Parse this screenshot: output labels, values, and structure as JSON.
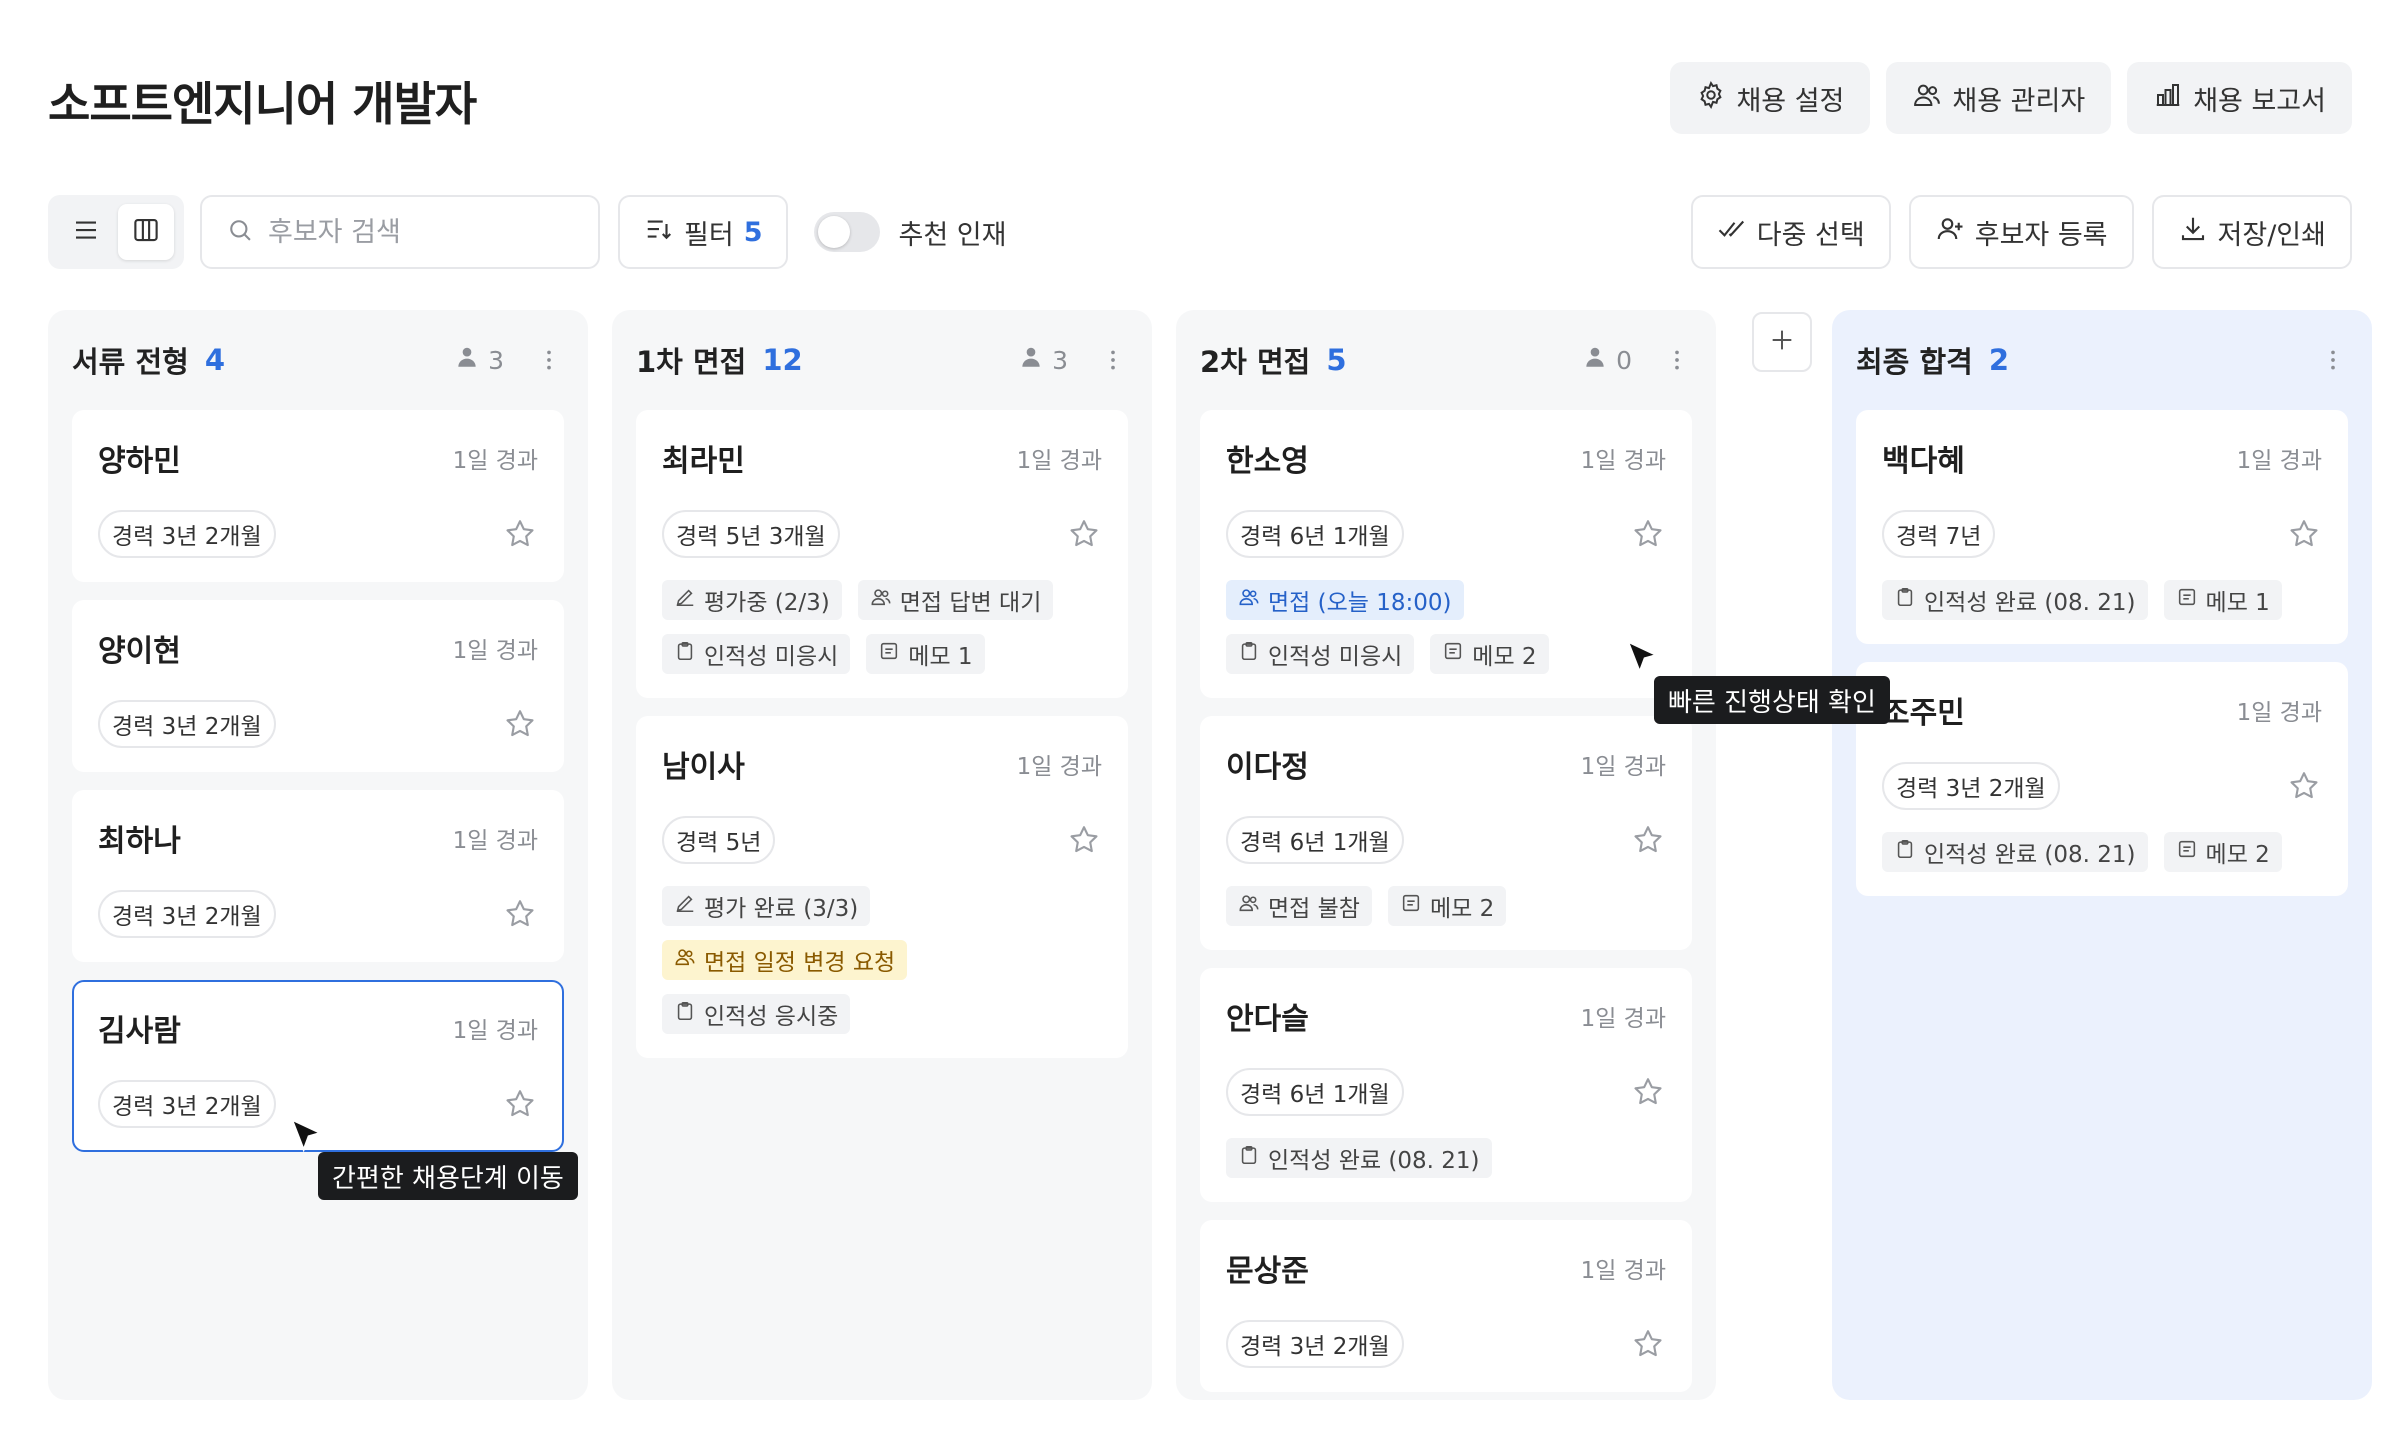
{
  "page": {
    "title": "소프트엔지니어 개발자"
  },
  "top_actions": [
    {
      "label": "채용 설정",
      "icon": "gear-icon"
    },
    {
      "label": "채용 관리자",
      "icon": "users-icon"
    },
    {
      "label": "채용 보고서",
      "icon": "bar-chart-icon"
    }
  ],
  "toolbar": {
    "search_placeholder": "후보자 검색",
    "filter_label": "필터",
    "filter_count": "5",
    "toggle_label": "추천 인재",
    "toggle_on": false,
    "actions": [
      {
        "label": "다중 선택",
        "icon": "double-check-icon"
      },
      {
        "label": "후보자 등록",
        "icon": "add-user-icon"
      },
      {
        "label": "저장/인쇄",
        "icon": "download-icon"
      }
    ]
  },
  "colors": {
    "accent": "#2f6fde",
    "final_column_bg": "#ebf1fd",
    "column_bg": "#f6f7f8"
  },
  "columns": [
    {
      "title": "서류 전형",
      "count": "4",
      "reviewers": "3",
      "cards": [
        {
          "name": "양하민",
          "elapsed": "1일 경과",
          "experience": "경력 3년 2개월",
          "tags": []
        },
        {
          "name": "양이현",
          "elapsed": "1일 경과",
          "experience": "경력 3년 2개월",
          "tags": []
        },
        {
          "name": "최하나",
          "elapsed": "1일 경과",
          "experience": "경력 3년 2개월",
          "tags": []
        },
        {
          "name": "김사람",
          "elapsed": "1일 경과",
          "experience": "경력 3년 2개월",
          "tags": []
        }
      ]
    },
    {
      "title": "1차 면접",
      "count": "12",
      "reviewers": "3",
      "cards": [
        {
          "name": "최라민",
          "elapsed": "1일 경과",
          "experience": "경력 5년 3개월",
          "tags": [
            {
              "label": "평가중 (2/3)",
              "icon": "pencil-icon"
            },
            {
              "label": "면접 답변 대기",
              "icon": "users-icon"
            },
            {
              "label": "인적성 미응시",
              "icon": "clipboard-icon"
            },
            {
              "label": "메모 1",
              "icon": "note-icon"
            }
          ]
        },
        {
          "name": "남이사",
          "elapsed": "1일 경과",
          "experience": "경력 5년",
          "tags": [
            {
              "label": "평가 완료 (3/3)",
              "icon": "pencil-icon"
            },
            {
              "label": "면접 일정 변경 요청",
              "icon": "users-icon"
            },
            {
              "label": "인적성 응시중",
              "icon": "clipboard-icon"
            }
          ]
        }
      ]
    },
    {
      "title": "2차 면접",
      "count": "5",
      "reviewers": "0",
      "cards": [
        {
          "name": "한소영",
          "elapsed": "1일 경과",
          "experience": "경력 6년 1개월",
          "tags": [
            {
              "label": "면접 (오늘 18:00)",
              "icon": "users-icon"
            },
            {
              "label": "인적성 미응시",
              "icon": "clipboard-icon"
            },
            {
              "label": "메모 2",
              "icon": "note-icon"
            }
          ]
        },
        {
          "name": "이다정",
          "elapsed": "1일 경과",
          "experience": "경력 6년 1개월",
          "tags": [
            {
              "label": "면접 불참",
              "icon": "users-icon"
            },
            {
              "label": "메모 2",
              "icon": "note-icon"
            }
          ]
        },
        {
          "name": "안다슬",
          "elapsed": "1일 경과",
          "experience": "경력 6년 1개월",
          "tags": [
            {
              "label": "인적성 완료 (08. 21)",
              "icon": "clipboard-icon"
            }
          ]
        },
        {
          "name": "문상준",
          "elapsed": "1일 경과",
          "experience": "경력 3년 2개월",
          "tags": []
        }
      ]
    },
    {
      "title": "최종 합격",
      "count": "2",
      "cards": [
        {
          "name": "백다혜",
          "elapsed": "1일 경과",
          "experience": "경력 7년",
          "tags": [
            {
              "label": "인적성 완료 (08. 21)",
              "icon": "clipboard-icon"
            },
            {
              "label": "메모 1",
              "icon": "note-icon"
            }
          ]
        },
        {
          "name": "조주민",
          "elapsed": "1일 경과",
          "experience": "경력 3년 2개월",
          "tags": [
            {
              "label": "인적성 완료 (08. 21)",
              "icon": "clipboard-icon"
            },
            {
              "label": "메모 2",
              "icon": "note-icon"
            }
          ]
        }
      ]
    }
  ],
  "tooltips": {
    "move_stage": "간편한 채용단계 이동",
    "quick_status": "빠른 진행상태 확인"
  }
}
